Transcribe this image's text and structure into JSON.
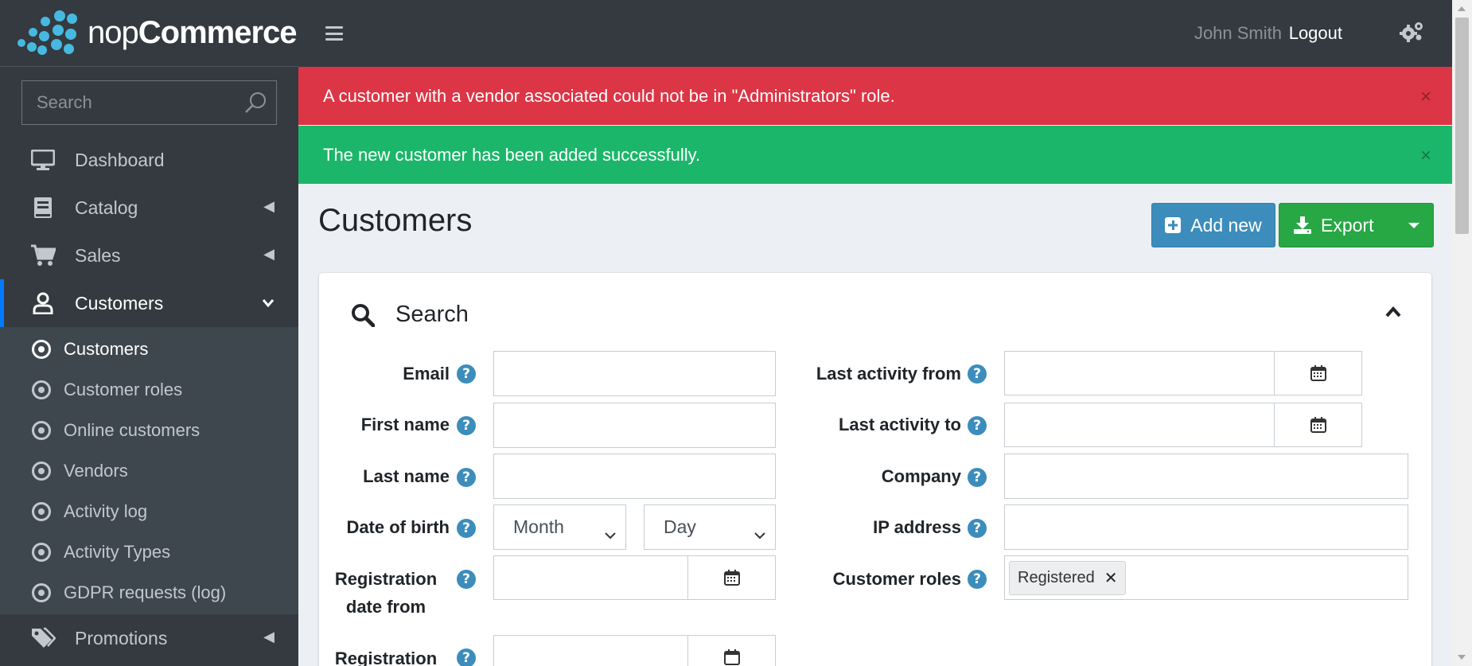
{
  "brand": {
    "name_light": "nop",
    "name_bold": "Commerce"
  },
  "sidebar": {
    "search_placeholder": "Search",
    "items": [
      {
        "label": "Dashboard",
        "icon": "desktop-icon",
        "has_arrow": false
      },
      {
        "label": "Catalog",
        "icon": "book-icon",
        "has_arrow": true
      },
      {
        "label": "Sales",
        "icon": "cart-icon",
        "has_arrow": true
      },
      {
        "label": "Customers",
        "icon": "user-icon",
        "active": true
      },
      {
        "label": "Promotions",
        "icon": "tags-icon",
        "has_arrow": true
      }
    ],
    "sub_items": [
      {
        "label": "Customers",
        "current": true
      },
      {
        "label": "Customer roles"
      },
      {
        "label": "Online customers"
      },
      {
        "label": "Vendors"
      },
      {
        "label": "Activity log"
      },
      {
        "label": "Activity Types"
      },
      {
        "label": "GDPR requests (log)"
      }
    ]
  },
  "topbar": {
    "user": "John Smith",
    "logout": "Logout"
  },
  "alerts": {
    "error": "A customer with a vendor associated could not be in \"Administrators\" role.",
    "success": "The new customer has been added successfully.",
    "close": "×"
  },
  "page": {
    "title": "Customers",
    "add_new": "Add new",
    "export": "Export"
  },
  "search": {
    "title": "Search",
    "labels": {
      "email": "Email",
      "first_name": "First name",
      "last_name": "Last name",
      "dob": "Date of birth",
      "reg_from_1": "Registration",
      "reg_from_2": "date from",
      "reg_to_1": "Registration",
      "last_activity_from": "Last activity from",
      "last_activity_to": "Last activity to",
      "company": "Company",
      "ip": "IP address",
      "roles": "Customer roles"
    },
    "dob_month": "Month",
    "dob_day": "Day",
    "role_tag": "Registered",
    "help": "?"
  },
  "colors": {
    "sidebar_bg": "#343a40",
    "alert_error": "#dc3545",
    "alert_success": "#1cb66a",
    "btn_primary": "#3c8dbc",
    "btn_success": "#28a745",
    "active_accent": "#007bff"
  }
}
